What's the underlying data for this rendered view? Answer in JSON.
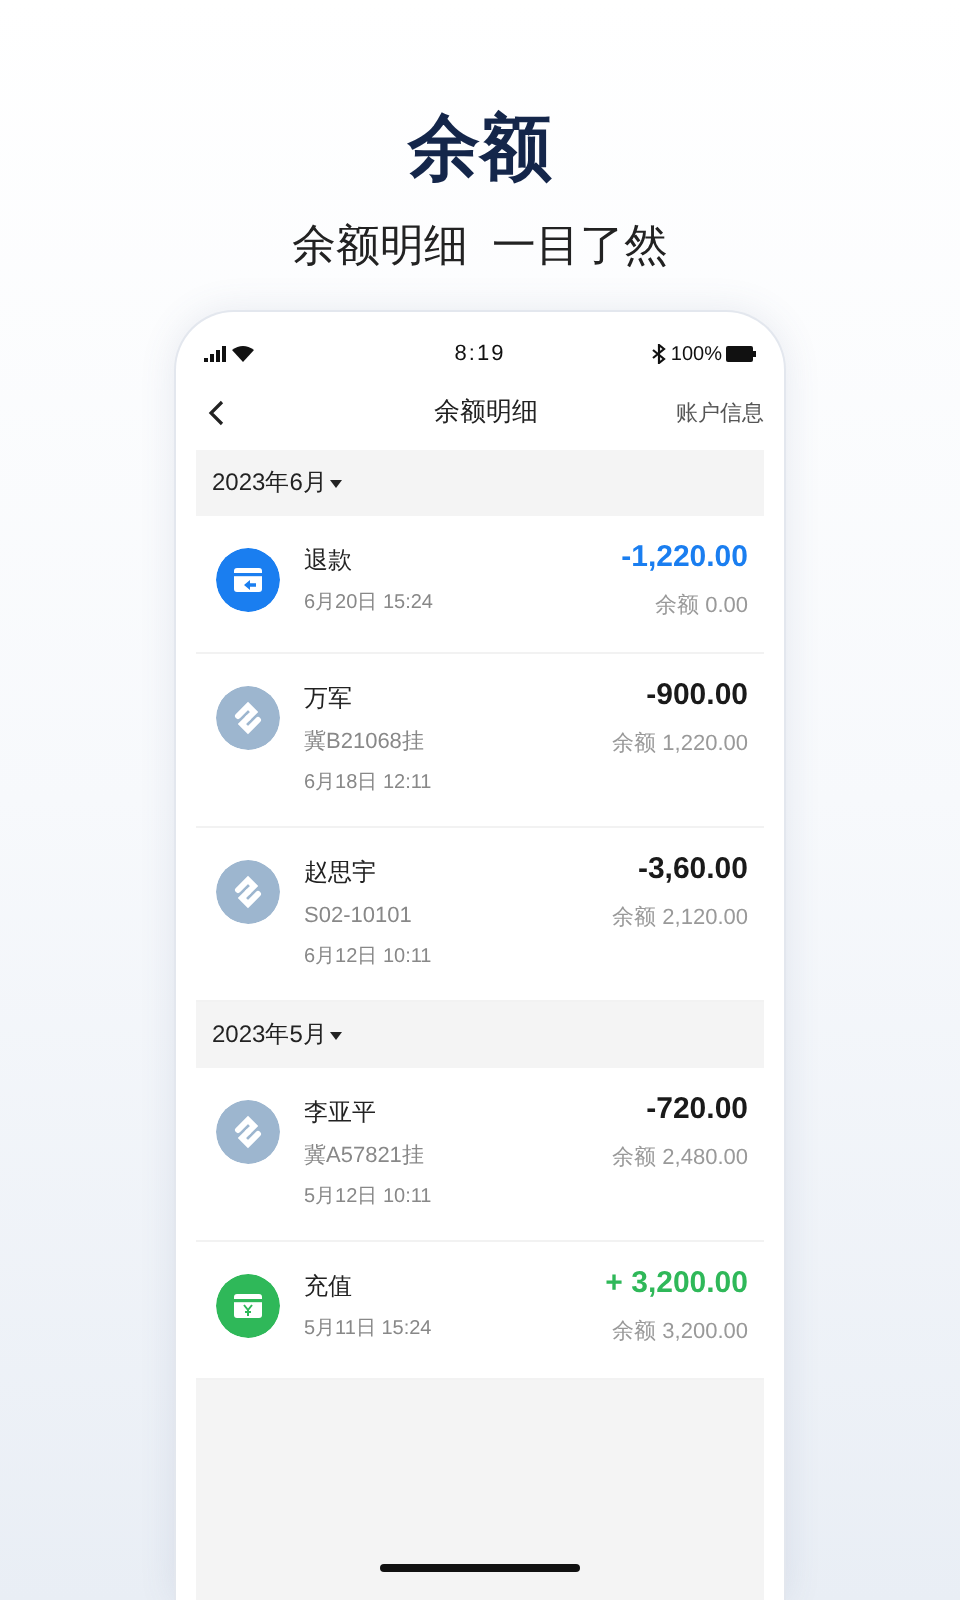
{
  "headline": {
    "title": "余额",
    "subtitle": "余额明细  一目了然"
  },
  "status_bar": {
    "time": "8:19",
    "battery": "100%"
  },
  "nav": {
    "title": "余额明细",
    "action": "账户信息"
  },
  "groups": [
    {
      "month": "2023年6月",
      "transactions": [
        {
          "kind": "refund",
          "name": "退款",
          "details": [
            "6月20日 15:24"
          ],
          "amount": "-1,220.00",
          "balance": "余额 0.00"
        },
        {
          "kind": "payment",
          "name": "万军",
          "details": [
            "冀B21068挂",
            "6月18日 12:11"
          ],
          "amount": "-900.00",
          "balance": "余额 1,220.00"
        },
        {
          "kind": "payment",
          "name": "赵思宇",
          "details": [
            "S02-10101",
            "6月12日 10:11"
          ],
          "amount": "-3,60.00",
          "balance": "余额 2,120.00"
        }
      ]
    },
    {
      "month": "2023年5月",
      "transactions": [
        {
          "kind": "payment",
          "name": "李亚平",
          "details": [
            "冀A57821挂",
            "5月12日 10:11"
          ],
          "amount": "-720.00",
          "balance": "余额 2,480.00"
        },
        {
          "kind": "topup",
          "name": "充值",
          "details": [
            "5月11日 15:24"
          ],
          "amount": "+ 3,200.00",
          "balance": "余额 3,200.00"
        }
      ]
    }
  ]
}
